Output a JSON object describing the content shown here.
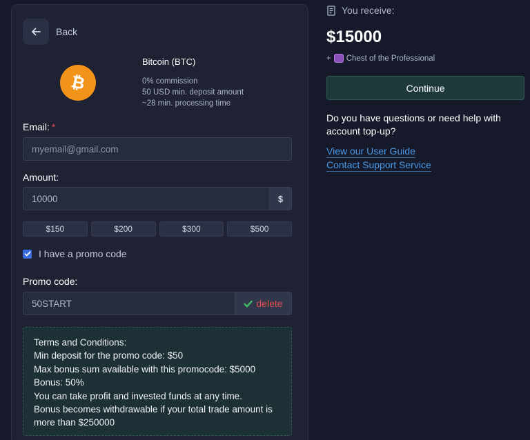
{
  "back": {
    "label": "Back"
  },
  "method": {
    "name": "Bitcoin (BTC)",
    "icon": "bitcoin-icon",
    "commission": "0% commission",
    "min_deposit": "50 USD min. deposit amount",
    "processing_time": "~28 min. processing time"
  },
  "email": {
    "label": "Email:",
    "required_mark": "*",
    "placeholder": "myemail@gmail.com",
    "value": ""
  },
  "amount": {
    "label": "Amount:",
    "value": "10000",
    "currency": "$"
  },
  "presets": [
    "$150",
    "$200",
    "$300",
    "$500"
  ],
  "promo_checkbox": {
    "label": "I have a promo code",
    "checked": true
  },
  "promo": {
    "label": "Promo code:",
    "value": "50START",
    "delete_label": "delete"
  },
  "terms": {
    "lines": [
      "Terms and Conditions:",
      "Min deposit for the promo code: $50",
      "Max bonus sum available with this promocode: $5000",
      "Bonus: 50%",
      "You can take profit and invested funds at any time.",
      "Bonus becomes withdrawable if your total trade amount is more than $250000"
    ]
  },
  "summary": {
    "receive_label": "You receive:",
    "amount": "$15000",
    "bonus_prefix": "+",
    "bonus_item": "Chest of the Professional",
    "continue_label": "Continue"
  },
  "help": {
    "question": "Do you have questions or need help with account top-up?",
    "links": [
      "View our User Guide",
      "Contact Support Service"
    ]
  },
  "colors": {
    "background": "#15192a",
    "panel": "#1e2233",
    "accent_link": "#4b9ae6",
    "danger": "#e24a4a",
    "bitcoin": "#f2931a"
  }
}
